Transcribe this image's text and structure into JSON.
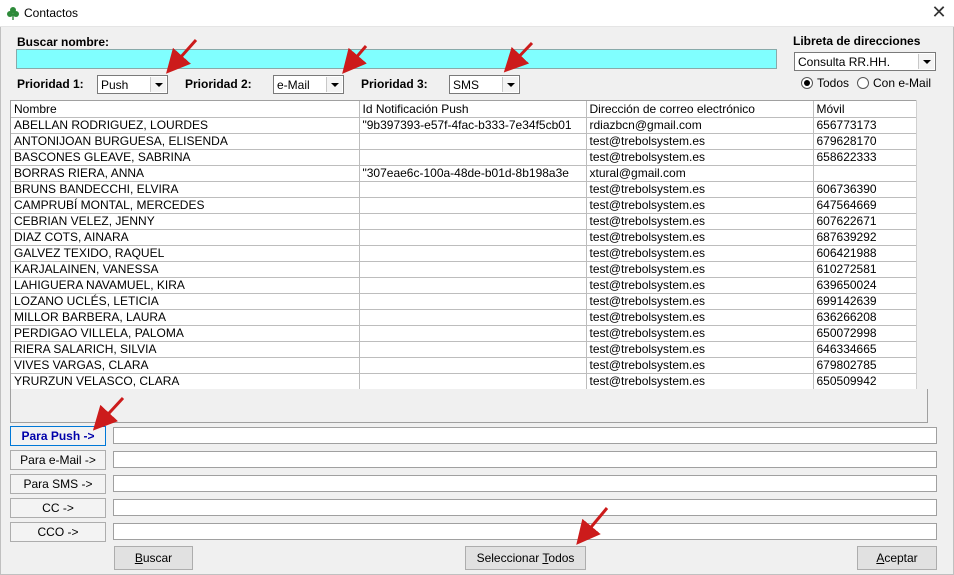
{
  "window": {
    "title": "Contactos"
  },
  "search": {
    "label": "Buscar nombre:",
    "value": ""
  },
  "address_book": {
    "label": "Libreta de direcciones",
    "selected": "Consulta RR.HH.",
    "radio_all": "Todos",
    "radio_email": "Con e-Mail"
  },
  "priorities": [
    {
      "label": "Prioridad 1:",
      "value": "Push"
    },
    {
      "label": "Prioridad 2:",
      "value": "e-Mail"
    },
    {
      "label": "Prioridad 3:",
      "value": "SMS"
    }
  ],
  "table": {
    "headers": [
      "Nombre",
      "Id Notificación Push",
      "Dirección de correo electrónico",
      "Móvil"
    ],
    "rows": [
      [
        "ABELLAN RODRIGUEZ, LOURDES",
        "\"9b397393-e57f-4fac-b333-7e34f5cb01",
        "rdiazbcn@gmail.com",
        "656773173"
      ],
      [
        "ANTONIJOAN BURGUESA, ELISENDA",
        "",
        "test@trebolsystem.es",
        "679628170"
      ],
      [
        "BASCONES GLEAVE, SABRINA",
        "",
        "test@trebolsystem.es",
        "658622333"
      ],
      [
        "BORRAS RIERA, ANNA",
        "\"307eae6c-100a-48de-b01d-8b198a3e",
        "xtural@gmail.com",
        ""
      ],
      [
        "BRUNS BANDECCHI, ELVIRA",
        "",
        "test@trebolsystem.es",
        "606736390"
      ],
      [
        "CAMPRUBÍ MONTAL, MERCEDES",
        "",
        "test@trebolsystem.es",
        "647564669"
      ],
      [
        "CEBRIAN VELEZ, JENNY",
        "",
        "test@trebolsystem.es",
        "607622671"
      ],
      [
        "DIAZ COTS, AINARA",
        "",
        "test@trebolsystem.es",
        "687639292"
      ],
      [
        "GALVEZ TEXIDO, RAQUEL",
        "",
        "test@trebolsystem.es",
        "606421988"
      ],
      [
        "KARJALAINEN, VANESSA",
        "",
        "test@trebolsystem.es",
        "610272581"
      ],
      [
        "LAHIGUERA NAVAMUEL, KIRA",
        "",
        "test@trebolsystem.es",
        "639650024"
      ],
      [
        "LOZANO UCLÉS, LETICIA",
        "",
        "test@trebolsystem.es",
        "699142639"
      ],
      [
        "MILLOR BARBERA, LAURA",
        "",
        "test@trebolsystem.es",
        "636266208"
      ],
      [
        "PERDIGAO VILLELA, PALOMA",
        "",
        "test@trebolsystem.es",
        "650072998"
      ],
      [
        "RIERA SALARICH, SILVIA",
        "",
        "test@trebolsystem.es",
        "646334665"
      ],
      [
        "VIVES VARGAS, CLARA",
        "",
        "test@trebolsystem.es",
        "679802785"
      ],
      [
        "YRURZUN VELASCO, CLARA",
        "",
        "test@trebolsystem.es",
        "650509942"
      ]
    ]
  },
  "recipients": [
    {
      "label": "Para Push ->",
      "value": ""
    },
    {
      "label": "Para e-Mail ->",
      "value": ""
    },
    {
      "label": "Para SMS ->",
      "value": ""
    },
    {
      "label": "CC ->",
      "value": ""
    },
    {
      "label": "CCO ->",
      "value": ""
    }
  ],
  "buttons": {
    "search_pre": "",
    "search_u": "B",
    "search_post": "uscar",
    "select_all_pre": "Seleccionar ",
    "select_all_u": "T",
    "select_all_post": "odos",
    "accept_pre": "",
    "accept_u": "A",
    "accept_post": "ceptar"
  },
  "colors": {
    "search_bg": "#80ffff",
    "annotation_arrow": "#cc1b1b",
    "default_button_text": "#0000aa"
  }
}
